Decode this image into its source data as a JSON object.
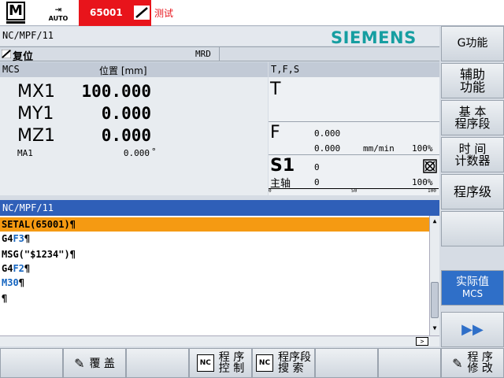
{
  "status_bar": {
    "mode_jog_label": "M",
    "mode_auto_label": "AUTO",
    "alarm_number": "65001",
    "alarm_text": "测试"
  },
  "channel": {
    "program_path": "NC/MPF/11",
    "brand": "SIEMENS",
    "reset_state": "复位",
    "mrd": "MRD"
  },
  "axes": {
    "header_system": "MCS",
    "header_position": "位置 [mm]",
    "rows": [
      {
        "name": "MX1",
        "value": "100.000"
      },
      {
        "name": "MY1",
        "value": "0.000"
      },
      {
        "name": "MZ1",
        "value": "0.000"
      }
    ],
    "extra": {
      "name": "MA1",
      "value": "0.000",
      "unit": "°"
    }
  },
  "tfs": {
    "header": "T,F,S",
    "tool_label": "T",
    "feed_label": "F",
    "feed_value": "0.000",
    "feed_actual": "0.000",
    "feed_unit": "mm/min",
    "feed_override": "100%",
    "spindle_label": "S1",
    "spindle_value": "0",
    "spindle_name": "主轴",
    "spindle_actual": "0",
    "spindle_override": "100%",
    "spindle_scale": [
      "0",
      "50",
      "100"
    ]
  },
  "program": {
    "header": "NC/MPF/11",
    "lines": [
      {
        "pre": "SETAL(65001)¶",
        "kw": "",
        "post": ""
      },
      {
        "pre": "G4",
        "kw": "F3",
        "post": "¶"
      },
      {
        "pre": "MSG(\"$1234\")¶",
        "kw": "",
        "post": ""
      },
      {
        "pre": "G4",
        "kw": "F2",
        "post": "¶"
      },
      {
        "pre": "",
        "kw": "M30",
        "post": "¶"
      },
      {
        "pre": "¶",
        "kw": "",
        "post": ""
      }
    ]
  },
  "right_softkeys": {
    "g_function": "G功能",
    "aux_function": "辅助\n功能",
    "basic_block": "基 本\n程序段",
    "timer_counter": "时 间\n计数器",
    "program_level": "程序级",
    "empty": "",
    "actual_value": "实际值",
    "actual_value_sub": "MCS",
    "more": "▶▶"
  },
  "bottom_softkeys": {
    "overstore": "覆 盖",
    "program_control": "程 序\n控 制",
    "block_search": "程序段\n搜 索",
    "program_edit": "程 序\n修 改",
    "nc_icon_text": "NC"
  },
  "colors": {
    "alarm_red": "#e8141b",
    "brand_teal": "#169ea1",
    "header_blue": "#2f5fb8",
    "active_line_orange": "#f59a12",
    "keyword_blue": "#1565c0"
  }
}
